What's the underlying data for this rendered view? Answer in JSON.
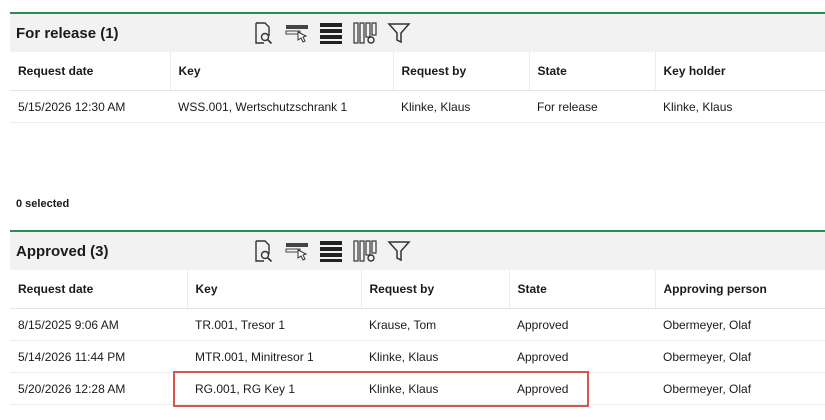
{
  "for_release": {
    "title": "For release (1)",
    "columns": [
      "Request date",
      "Key",
      "Request by",
      "State",
      "Key holder"
    ],
    "rows": [
      [
        "5/15/2026 12:30 AM",
        "WSS.001, Wertschutzschrank 1",
        "Klinke, Klaus",
        "For release",
        "Klinke, Klaus"
      ]
    ]
  },
  "selection": {
    "text": "0 selected"
  },
  "approved": {
    "title": "Approved (3)",
    "columns": [
      "Request date",
      "Key",
      "Request by",
      "State",
      "Approving person"
    ],
    "rows": [
      [
        "8/15/2025 9:06 AM",
        "TR.001, Tresor 1",
        "Krause, Tom",
        "Approved",
        "Obermeyer, Olaf"
      ],
      [
        "5/14/2026 11:44 PM",
        "MTR.001, Minitresor 1",
        "Klinke, Klaus",
        "Approved",
        "Obermeyer, Olaf"
      ],
      [
        "5/20/2026 12:28 AM",
        "RG.001, RG Key 1",
        "Klinke, Klaus",
        "Approved",
        "Obermeyer, Olaf"
      ]
    ]
  },
  "toolbar_icons": [
    "document-search-icon",
    "select-cursor-icon",
    "list-rows-icon",
    "column-settings-icon",
    "filter-icon"
  ],
  "colors": {
    "section_accent": "#2e8b4f",
    "highlight": "#d9534f"
  }
}
